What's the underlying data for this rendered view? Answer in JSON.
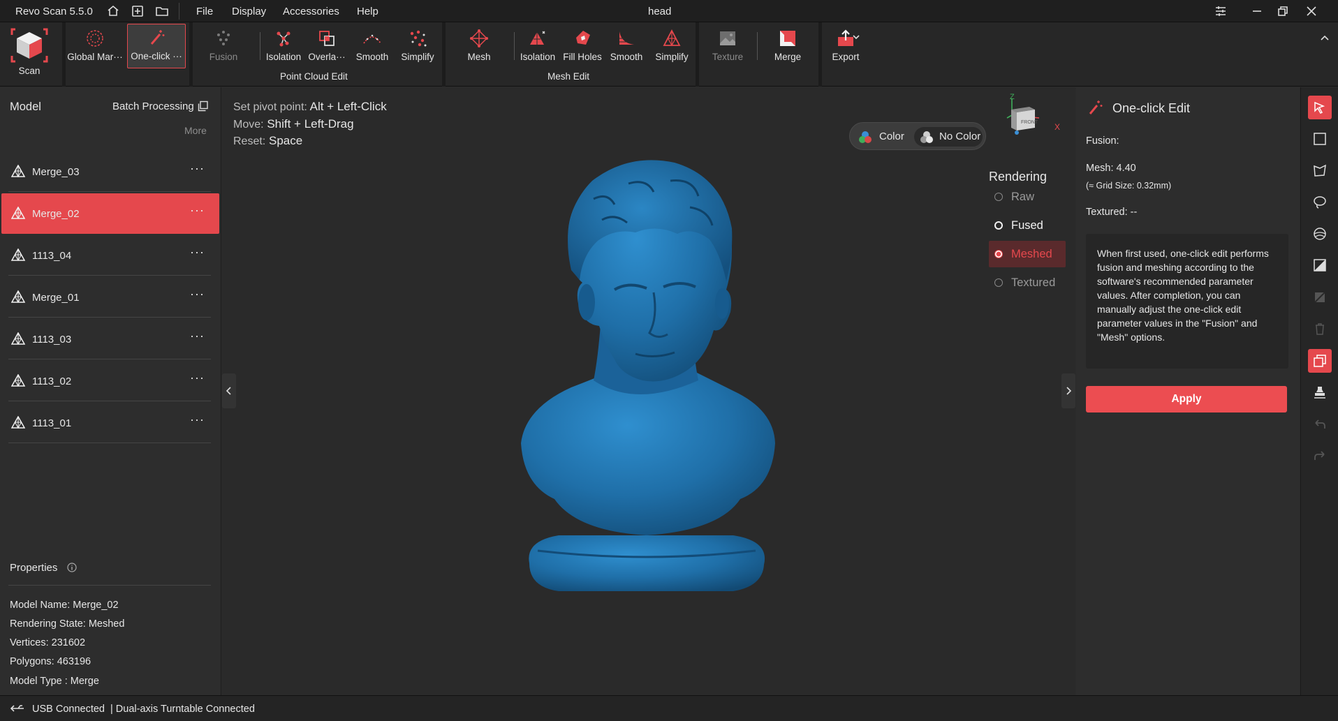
{
  "window": {
    "app_name": "Revo Scan 5.5.0",
    "title": "head"
  },
  "menu": [
    "File",
    "Display",
    "Accessories",
    "Help"
  ],
  "ribbon": {
    "scan": "Scan",
    "global_markers": "Global Mar···",
    "one_click": "One-click ···",
    "fusion": "Fusion",
    "pc_isolation": "Isolation",
    "pc_overlap": "Overla···",
    "pc_smooth": "Smooth",
    "pc_simplify": "Simplify",
    "point_cloud_group": "Point Cloud Edit",
    "mesh": "Mesh",
    "mesh_isolation": "Isolation",
    "fill_holes": "Fill Holes",
    "mesh_smooth": "Smooth",
    "mesh_simplify": "Simplify",
    "mesh_group": "Mesh Edit",
    "texture": "Texture",
    "merge": "Merge",
    "export": "Export"
  },
  "left_panel": {
    "model_label": "Model",
    "batch_processing": "Batch Processing",
    "more": "More",
    "models": [
      "Merge_03",
      "Merge_02",
      "1113_04",
      "Merge_01",
      "1113_03",
      "1113_02",
      "1113_01"
    ],
    "selected_index": 1,
    "dots": "···",
    "properties_label": "Properties",
    "properties": {
      "model_name": "Model Name:  Merge_02",
      "rendering_state": "Rendering State:  Meshed",
      "vertices": "Vertices:  231602",
      "polygons": "Polygons:  463196",
      "model_type": "Model Type :  Merge"
    }
  },
  "viewport": {
    "hint_pivot_label": "Set pivot point:",
    "hint_pivot_keys": "Alt + Left-Click",
    "hint_move_label": "Move:",
    "hint_move_keys": "Shift + Left-Drag",
    "hint_reset_label": "Reset:",
    "hint_reset_keys": "Space",
    "color_label": "Color",
    "no_color_label": "No Color",
    "cube_face": "FRONT",
    "axis_z": "Z",
    "axis_x": "X",
    "rendering_title": "Rendering",
    "rendering_options": [
      "Raw",
      "Fused",
      "Meshed",
      "Textured"
    ],
    "rendering_selected": "Meshed",
    "model_color": "#1f6fa8",
    "accent": "#e5484d"
  },
  "right_panel": {
    "title": "One-click Edit",
    "fusion": "Fusion:",
    "mesh": "Mesh:  4.40",
    "grid_size": "(≈ Grid Size: 0.32mm)",
    "textured": "Textured: --",
    "description": "When first used, one-click edit performs fusion and meshing according to the software's recommended parameter values. After completion, you can manually adjust the one-click edit parameter values in the \"Fusion\" and \"Mesh\" options.",
    "apply": "Apply"
  },
  "status": {
    "usb": "USB Connected",
    "turntable": "| Dual-axis Turntable Connected"
  }
}
